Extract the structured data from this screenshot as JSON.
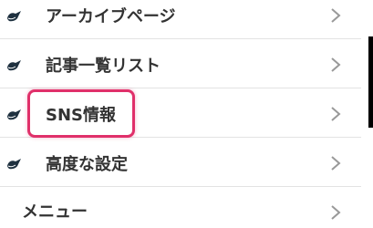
{
  "menu": {
    "items": [
      {
        "label": "アーカイブページ",
        "icon": "bird-icon"
      },
      {
        "label": "記事一覧リスト",
        "icon": "bird-icon"
      },
      {
        "label": "SNS情報",
        "icon": "bird-icon",
        "highlighted": true
      },
      {
        "label": "高度な設定",
        "icon": "bird-icon"
      }
    ],
    "footer_label": "メニュー"
  },
  "colors": {
    "text": "#333333",
    "chevron": "#999999",
    "divider": "#e3e3e3",
    "highlight": "#e0306a",
    "bird_icon": "#1f3140"
  }
}
